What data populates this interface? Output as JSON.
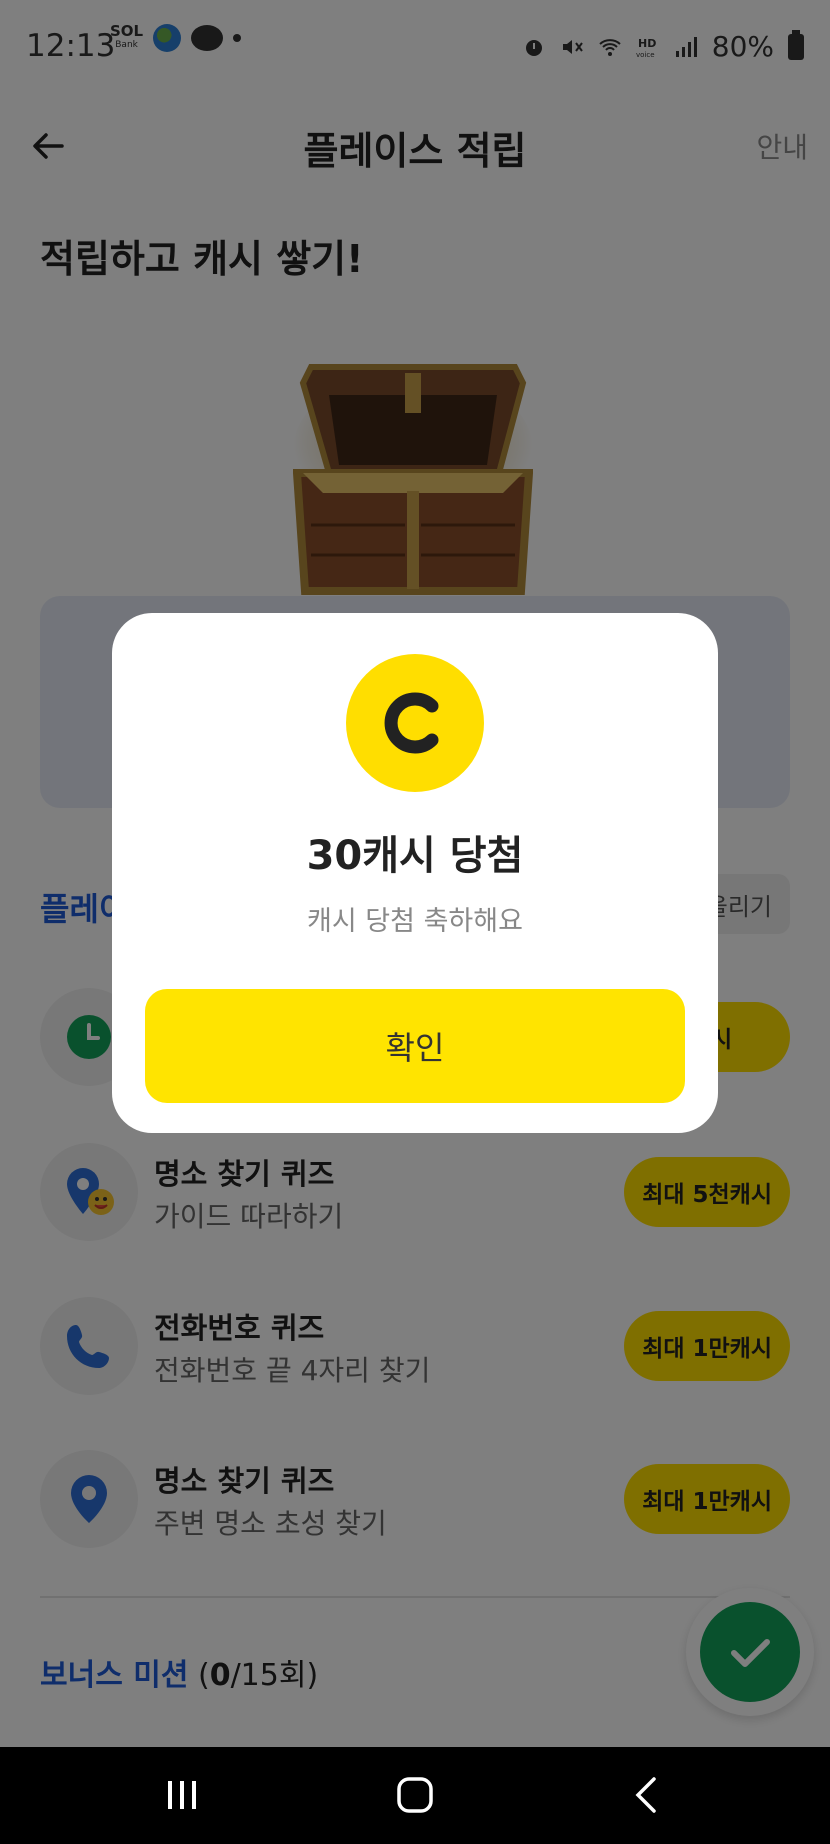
{
  "status_bar": {
    "time": "12:13",
    "battery": "80%",
    "icons": [
      "sol-bank-icon",
      "globe-icon",
      "talk-icon",
      "notification-dot",
      "alarm-icon",
      "mute-icon",
      "wifi-icon",
      "hd-voice-icon",
      "signal-icon",
      "battery-icon"
    ]
  },
  "header": {
    "title": "플레이스 적립",
    "info_label": "안내"
  },
  "headline": "적립하고 캐시 쌓기!",
  "section": {
    "title_partial": "플레이",
    "sort_label_partial": "올리기"
  },
  "missions": [
    {
      "title": "",
      "subtitle": "",
      "badge": "캐시",
      "icon": "clock-icon"
    },
    {
      "title": "명소 찾기 퀴즈",
      "subtitle": "가이드 따라하기",
      "badge": "최대 5천캐시",
      "icon": "location-emoji-icon"
    },
    {
      "title": "전화번호 퀴즈",
      "subtitle": "전화번호 끝 4자리 찾기",
      "badge": "최대 1만캐시",
      "icon": "phone-icon"
    },
    {
      "title": "명소 찾기 퀴즈",
      "subtitle": "주변 명소 초성 찾기",
      "badge": "최대 1만캐시",
      "icon": "location-pin-icon"
    }
  ],
  "bonus": {
    "label": "보너스 미션",
    "progress_done": "0",
    "progress_total": "/15회"
  },
  "modal": {
    "coin_letter": "C",
    "title": "30캐시 당첨",
    "subtitle": "캐시 당첨 축하해요",
    "confirm_label": "확인"
  },
  "colors": {
    "accent_yellow": "#ffde00",
    "brand_blue": "#1e5bd6",
    "success_green": "#13a35b"
  }
}
